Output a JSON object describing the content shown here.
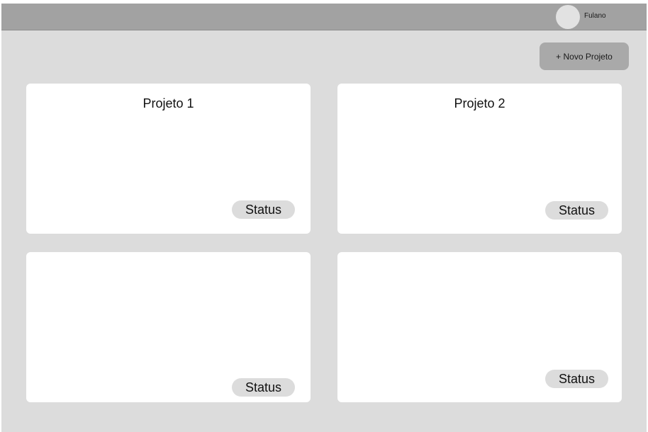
{
  "header": {
    "user_name": "Fulano"
  },
  "toolbar": {
    "new_project_label": "+ Novo Projeto"
  },
  "projects": [
    {
      "title": "Projeto 1",
      "status": "Status"
    },
    {
      "title": "Projeto 2",
      "status": "Status"
    },
    {
      "title": "",
      "status": "Status"
    },
    {
      "title": "",
      "status": "Status"
    }
  ]
}
